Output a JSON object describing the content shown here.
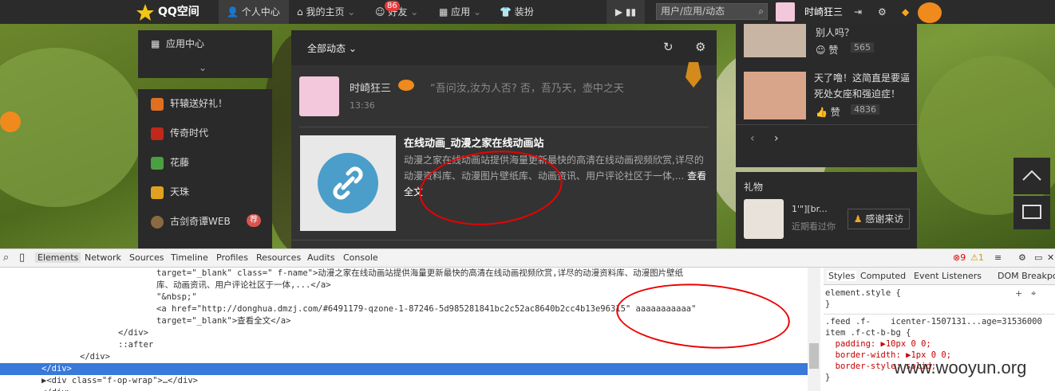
{
  "navbar": {
    "logo": "QQ空间",
    "items": [
      "个人中心",
      "我的主页",
      "好友",
      "应用",
      "装扮"
    ],
    "friends_badge": "86",
    "search_placeholder": "用户/应用/动态",
    "username": "时崎狂三"
  },
  "app_panel": {
    "title": "应用中心"
  },
  "side_apps": [
    {
      "label": "轩辕送好礼！",
      "color": "#e07020"
    },
    {
      "label": "传奇时代",
      "color": "#c0281c"
    },
    {
      "label": "花藤",
      "color": "#4aa040"
    },
    {
      "label": "天珠",
      "color": "#e0a020"
    },
    {
      "label": "古剑奇谭WEB",
      "color": "#8a6a40",
      "badge": "荐"
    }
  ],
  "feed": {
    "filter": "全部动态",
    "post": {
      "author": "时崎狂三",
      "quote": "“吾问汝,汝为人否? 否，吾乃天，壶中之天",
      "time": "13:36",
      "share_title": "在线动画_动漫之家在线动画站",
      "share_desc": "动漫之家在线动画站提供海量更新最快的高清在线动画视频欣赏,详尽的动漫资料库、动漫图片壁纸库、动画资讯、用户评论社区于一体,...",
      "read_more": "查看全文"
    }
  },
  "right_panel": {
    "items": [
      {
        "text": "别人吗？",
        "likes": "565",
        "like_label": "赞"
      },
      {
        "text": "天了噜！这简直是要逼死处女座和强迫症！",
        "likes": "4836",
        "like_label": "赞"
      }
    ],
    "gift": {
      "title": "礼物",
      "name": "1'\"][br...",
      "sub": "近期看过你",
      "thanks": "感谢来访"
    }
  },
  "devtools": {
    "tabs": [
      "Elements",
      "Network",
      "Sources",
      "Timeline",
      "Profiles",
      "Resources",
      "Audits",
      "Console"
    ],
    "errors": "9",
    "warnings": "1",
    "code_lines": [
      {
        "indent": 4,
        "html": "target=\"_blank\" class=\" f-name\">动漫之家在线动画站提供海量更新最快的高清在线动画视频欣赏,详尽的动漫资料库、动漫图片壁纸"
      },
      {
        "indent": 4,
        "text": "库、动画资讯、用户评论社区于一体,...</a>"
      },
      {
        "indent": 4,
        "text": "\"&nbsp;\""
      },
      {
        "indent": 4,
        "text": "<a href=\"http://donghua.dmzj.com/#6491179-qzone-1-87246-5d985281841bc2c52ac8640b2cc4b13e96315\" aaaaaaaaaaa\""
      },
      {
        "indent": 4,
        "text": "target=\"_blank\">查看全文</a>"
      },
      {
        "indent": 3,
        "text": "</div>"
      },
      {
        "indent": 3,
        "text": "::after"
      },
      {
        "indent": 2,
        "text": "</div>"
      },
      {
        "indent": 1,
        "text": "</div>",
        "selected": true
      },
      {
        "indent": 1,
        "text": "▶<div class=\"f-op-wrap\">…</div>"
      },
      {
        "indent": 1,
        "text": "</div>"
      }
    ],
    "styles_tabs": [
      "Styles",
      "Computed",
      "Event Listeners",
      "DOM Breakpoints"
    ],
    "styles": [
      "element.style {",
      "}",
      ".feed .f-    icenter-1507131...age=31536000",
      "item .f-ct-b-bg {",
      "  padding: ▶10px 0 0;",
      "  border-width: ▶1px 0 0;",
      "  border-style: solid;",
      "}"
    ]
  },
  "watermark": "www.wooyun.org"
}
